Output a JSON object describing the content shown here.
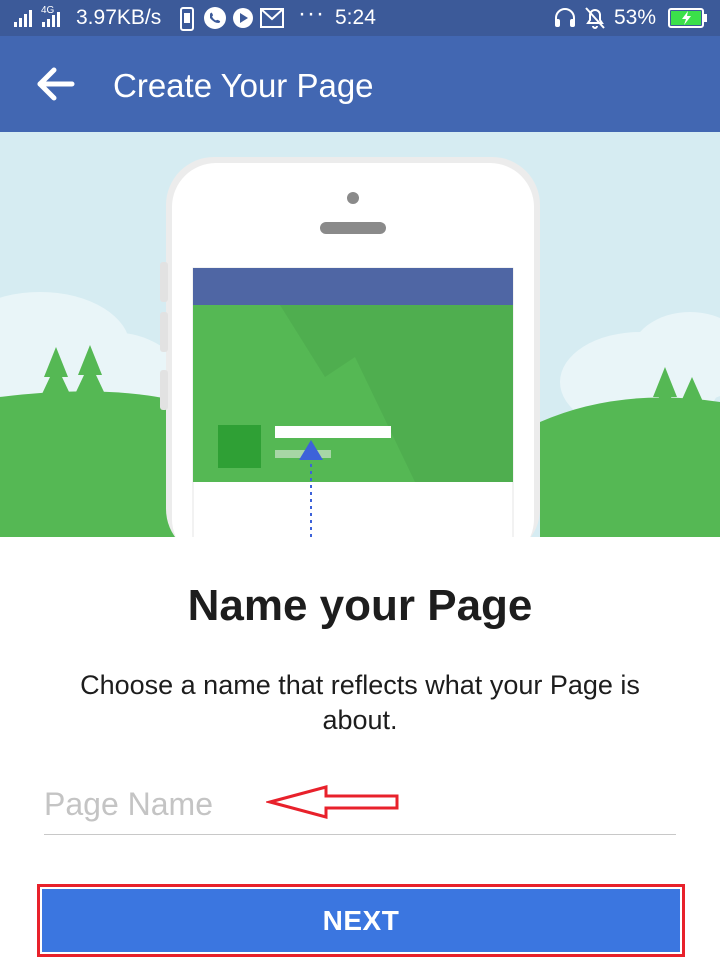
{
  "status_bar": {
    "network_type": "4G",
    "speed": "3.97KB/s",
    "more_dots": "···",
    "time": "5:24",
    "battery_percent": "53%"
  },
  "app_bar": {
    "back_icon": "arrow-left-icon",
    "title": "Create Your Page"
  },
  "main": {
    "heading": "Name your Page",
    "subtitle": "Choose a name that reflects what your Page is about.",
    "page_name_input": {
      "placeholder": "Page Name",
      "value": ""
    },
    "next_label": "NEXT"
  },
  "colors": {
    "status_bar": "#3c5a99",
    "app_bar": "#4267b2",
    "next_button": "#3b76e0",
    "highlight": "#e8212b",
    "hill_green": "#55b854"
  }
}
